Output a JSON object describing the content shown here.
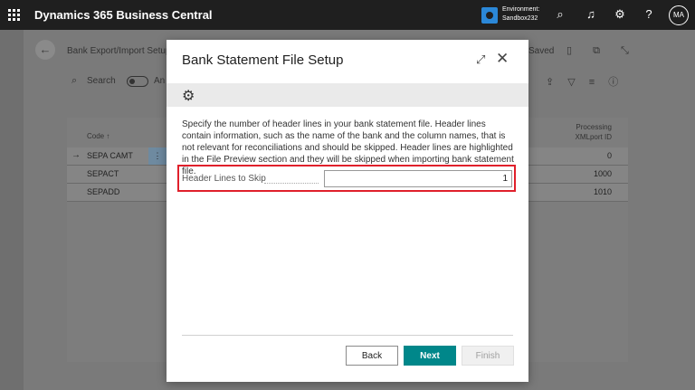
{
  "app": {
    "title": "Dynamics 365 Business Central",
    "environment_label": "Environment:",
    "environment_name": "Sandbox232",
    "user_initials": "MA"
  },
  "background_page": {
    "title": "Bank Export/Import Setup",
    "saved_label": "Saved",
    "search_label": "Search",
    "analyze_label": "An",
    "columns": {
      "code": "Code ↑",
      "processing": "Processing XMLport ID"
    },
    "rows": [
      {
        "code": "SEPA CAMT",
        "processing": "0"
      },
      {
        "code": "SEPACT",
        "processing": "1000"
      },
      {
        "code": "SEPADD",
        "processing": "1010"
      }
    ]
  },
  "dialog": {
    "title": "Bank Statement File Setup",
    "description": "Specify the number of header lines in your bank statement file. Header lines contain information, such as the name of the bank and the column names, that is not relevant for reconciliations and should be skipped. Header lines are highlighted in the File Preview section and they will be skipped when importing bank statement file.",
    "field_label": "Header Lines to Skip",
    "field_value": "1",
    "buttons": {
      "back": "Back",
      "next": "Next",
      "finish": "Finish"
    }
  },
  "colors": {
    "topbar": "#1f1f1f",
    "accent": "#00878a",
    "highlight_border": "#e0202b"
  }
}
